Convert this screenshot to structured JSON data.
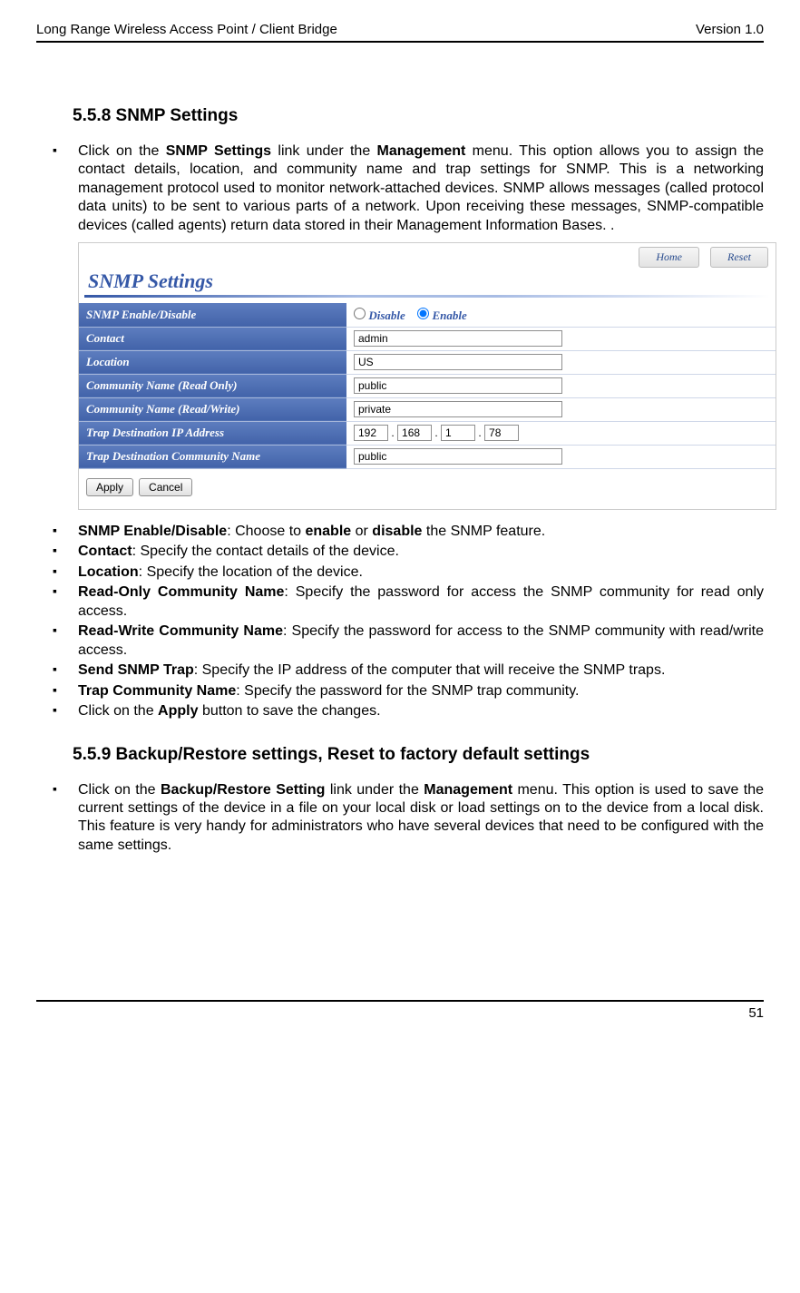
{
  "header": {
    "left": "Long Range Wireless Access Point / Client Bridge",
    "right": "Version 1.0"
  },
  "section1": {
    "heading": "5.5.8   SNMP Settings"
  },
  "p1": {
    "pre": "Click on the ",
    "b1": "SNMP Settings",
    "mid1": " link under the ",
    "b2": "Management",
    "rest": " menu. This option allows you to assign the contact details, location, and community name and trap settings for SNMP. This is a networking management protocol used to monitor network-attached devices. SNMP allows messages (called protocol data units) to be sent to various parts of a network. Upon receiving these messages, SNMP-compatible devices (called agents) return data stored in their Management Information Bases. ."
  },
  "screenshot": {
    "title": "SNMP Settings",
    "btn_home": "Home",
    "btn_reset": "Reset",
    "rows": {
      "r0": "SNMP Enable/Disable",
      "r1": "Contact",
      "r2": "Location",
      "r3": "Community Name (Read Only)",
      "r4": "Community Name (Read/Write)",
      "r5": "Trap Destination IP Address",
      "r6": "Trap Destination Community Name"
    },
    "radio_disable": "Disable",
    "radio_enable": "Enable",
    "val_contact": "admin",
    "val_location": "US",
    "val_ro": "public",
    "val_rw": "private",
    "ip": {
      "a": "192",
      "b": "168",
      "c": "1",
      "d": "78"
    },
    "val_trapcomm": "public",
    "btn_apply": "Apply",
    "btn_cancel": "Cancel"
  },
  "bullets": {
    "b1": {
      "bold": "SNMP Enable/Disable",
      "text1": ": Choose to ",
      "bold2": "enable",
      "text2": " or ",
      "bold3": "disable",
      "text3": " the SNMP feature."
    },
    "b2": {
      "bold": "Contact",
      "text": ": Specify the contact details of the device."
    },
    "b3": {
      "bold": "Location",
      "text": ": Specify the location of the device."
    },
    "b4": {
      "bold": "Read-Only Community Name",
      "text": ": Specify the password for access the SNMP community for read only access."
    },
    "b5": {
      "bold": "Read-Write Community Name",
      "text": ": Specify the password for access to the SNMP community with read/write access."
    },
    "b6": {
      "bold": "Send SNMP Trap",
      "text": ": Specify the IP address of the computer that will receive the SNMP traps."
    },
    "b7": {
      "bold": "Trap Community Name",
      "text": ": Specify the password for the SNMP trap community."
    },
    "b8": {
      "pre": "Click on the ",
      "bold": "Apply",
      "post": " button to save the changes."
    }
  },
  "section2": {
    "heading": "5.5.9   Backup/Restore settings, Reset to factory default settings"
  },
  "p2": {
    "pre": "Click on the ",
    "b1": "Backup/Restore Setting",
    "mid1": " link under the ",
    "b2": "Management",
    "rest": " menu. This option is used to save the current settings of the device in a file on your local disk or load settings on to the device from a local disk. This feature is very handy for administrators who have several devices that need to be configured with the same settings."
  },
  "page_num": "51"
}
